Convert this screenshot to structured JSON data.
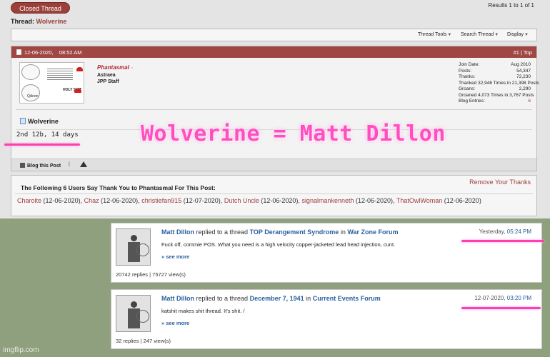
{
  "forum": {
    "closed_label": "Closed Thread",
    "results": "Results 1 to 1 of 1",
    "thread_prefix": "Thread:",
    "thread_name": "Wolverine",
    "tools": [
      "Thread Tools",
      "Search Thread",
      "Display"
    ]
  },
  "post": {
    "date": "12-06-2020,",
    "time": "08:52 AM",
    "number": "#1 | Top",
    "user": {
      "name": "Phantasmal",
      "title": "Astraea",
      "group": "JPP Staff"
    },
    "sig": {
      "qanon": "QAnon",
      "holy": "HOLY SHIT"
    },
    "stats": [
      {
        "label": "Join Date:",
        "value": "Aug 2010",
        "red": false
      },
      {
        "label": "Posts:",
        "value": "54,347",
        "red": false
      },
      {
        "label": "Thanks:",
        "value": "72,230",
        "red": false
      },
      {
        "label": "Thanked 32,946 Times in 21,398 Posts",
        "value": "",
        "red": false
      },
      {
        "label": "Groans:",
        "value": "2,290",
        "red": false
      },
      {
        "label": "Groaned 4,073 Times in 3,767 Posts",
        "value": "",
        "red": false
      },
      {
        "label": "Blog Entries:",
        "value": "6",
        "red": true
      }
    ],
    "title": "Wolverine",
    "body": "2nd 12b, 14 days",
    "footer": {
      "blog": "Blog this Post",
      "sep": "|"
    }
  },
  "thanks": {
    "header": "The Following 6 Users Say Thank You to Phantasmal For This Post:",
    "remove": "Remove Your Thanks",
    "users": [
      {
        "name": "Charoite",
        "date": "(12-06-2020),",
        "color": "#9b3f3b"
      },
      {
        "name": "Chaz",
        "date": "(12-06-2020),",
        "color": "#9b3f3b"
      },
      {
        "name": "christiefan915",
        "date": "(12-07-2020),",
        "color": "#9b3f3b"
      },
      {
        "name": "Dutch Uncle",
        "date": "(12-06-2020),",
        "color": "#9b3f3b"
      },
      {
        "name": "signalmankenneth",
        "date": "(12-06-2020),",
        "color": "#9b3f3b"
      },
      {
        "name": "ThatOwlWoman",
        "date": "(12-06-2020)",
        "color": "#9b3f3b"
      }
    ]
  },
  "overlay_text": "Wolverine = Matt Dillon",
  "activities": [
    {
      "user": "Matt Dillon",
      "verb": "replied to a thread",
      "thread": "TOP Derangement Syndrome",
      "in": "in",
      "forum": "War Zone Forum",
      "date": "Yesterday,",
      "time": "05:24 PM",
      "snippet": "Fuck off, commie POS. What you need is a high velocity copper-jacketed lead head injection, cunt.",
      "more": "» see more",
      "stats": "20742 replies | 75727 view(s)"
    },
    {
      "user": "Matt Dillon",
      "verb": "replied to a thread",
      "thread": "December 7, 1941",
      "in": "in",
      "forum": "Current Events Forum",
      "date": "12-07-2020,",
      "time": "03:20 PM",
      "snippet": "katshit makes shit thread. It's shit. /",
      "more": "» see more",
      "stats": "32 replies | 247 view(s)"
    }
  ],
  "watermark": "imgflip.com",
  "colors": {
    "accent": "#9b3f3b",
    "header_bar": "#a04743",
    "link_blue": "#2a5f9e",
    "highlight_pink": "#ff3fb0",
    "background_green": "#8fa07f"
  }
}
